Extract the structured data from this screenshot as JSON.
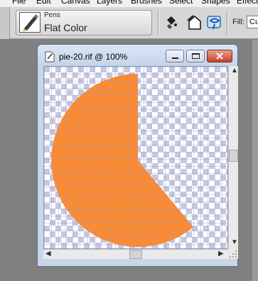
{
  "menu": [
    "File",
    "Edit",
    "Canvas",
    "Layers",
    "Brushes",
    "Select",
    "Shapes",
    "Effects"
  ],
  "tool": {
    "category": "Pens",
    "name": "Flat Color"
  },
  "toolbar": {
    "fill_label": "Fill:",
    "fill_value": "Cu"
  },
  "document": {
    "title": "pie-20.rif @ 100%"
  },
  "canvas": {
    "fill_color": "#ff8a2c",
    "grid_color": "#8c9cf0"
  },
  "icons": [
    "pen-tool-icon",
    "paint-bucket-icon",
    "fill-shape-icon",
    "lasso-icon",
    "document-icon",
    "minimize-icon",
    "maximize-icon",
    "close-icon"
  ]
}
